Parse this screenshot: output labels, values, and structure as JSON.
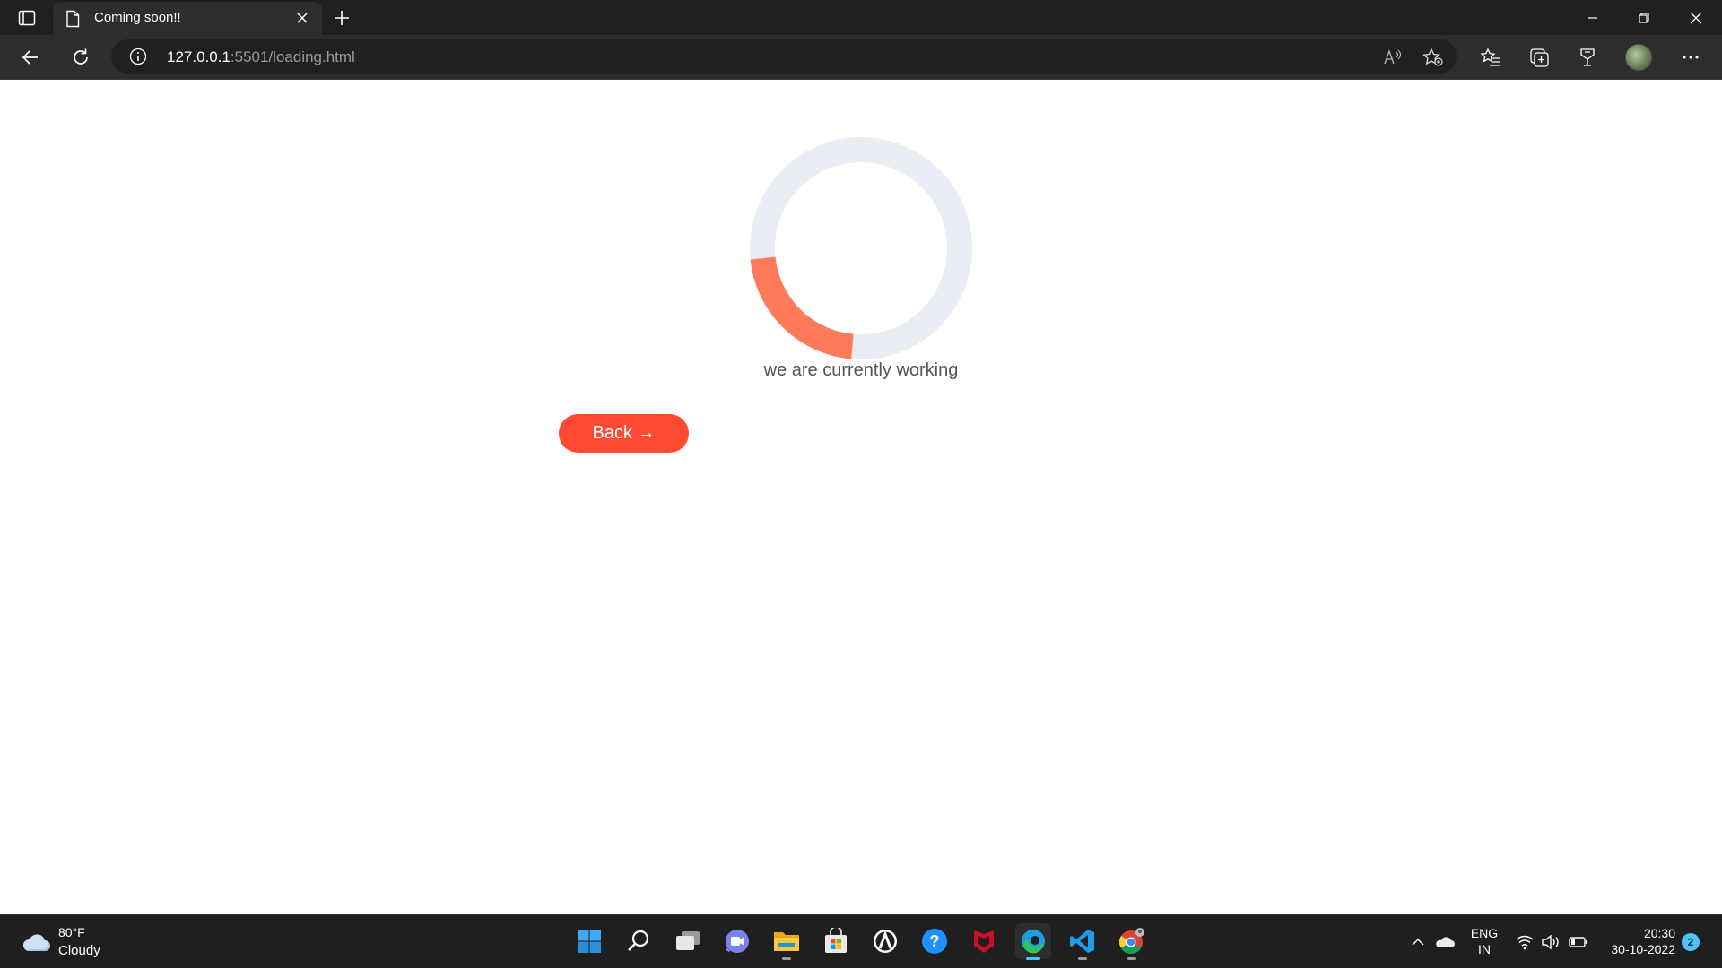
{
  "browser": {
    "tab": {
      "title": "Coming soon!!"
    },
    "address": {
      "host": "127.0.0.1",
      "path": ":5501/loading.html"
    }
  },
  "page": {
    "loader": {
      "caption": "we are currently working",
      "track_color": "#eaeef4",
      "arc_color": "#ff7a59",
      "progress_fraction": 0.22
    },
    "back_button": {
      "label": "Back →",
      "color": "#ff4a33"
    }
  },
  "taskbar": {
    "weather": {
      "temp": "80°F",
      "condition": "Cloudy",
      "icon": "cloud-icon"
    },
    "apps": [
      "start-icon",
      "search-icon",
      "task-view-icon",
      "teams-chat-icon",
      "file-explorer-icon",
      "microsoft-store-icon",
      "app-icon",
      "help-icon",
      "mcafee-icon",
      "edge-icon",
      "vscode-icon",
      "chrome-icon"
    ],
    "tray": {
      "language_line1": "ENG",
      "language_line2": "IN",
      "time": "20:30",
      "date": "30-10-2022",
      "notification_count": "2"
    }
  }
}
